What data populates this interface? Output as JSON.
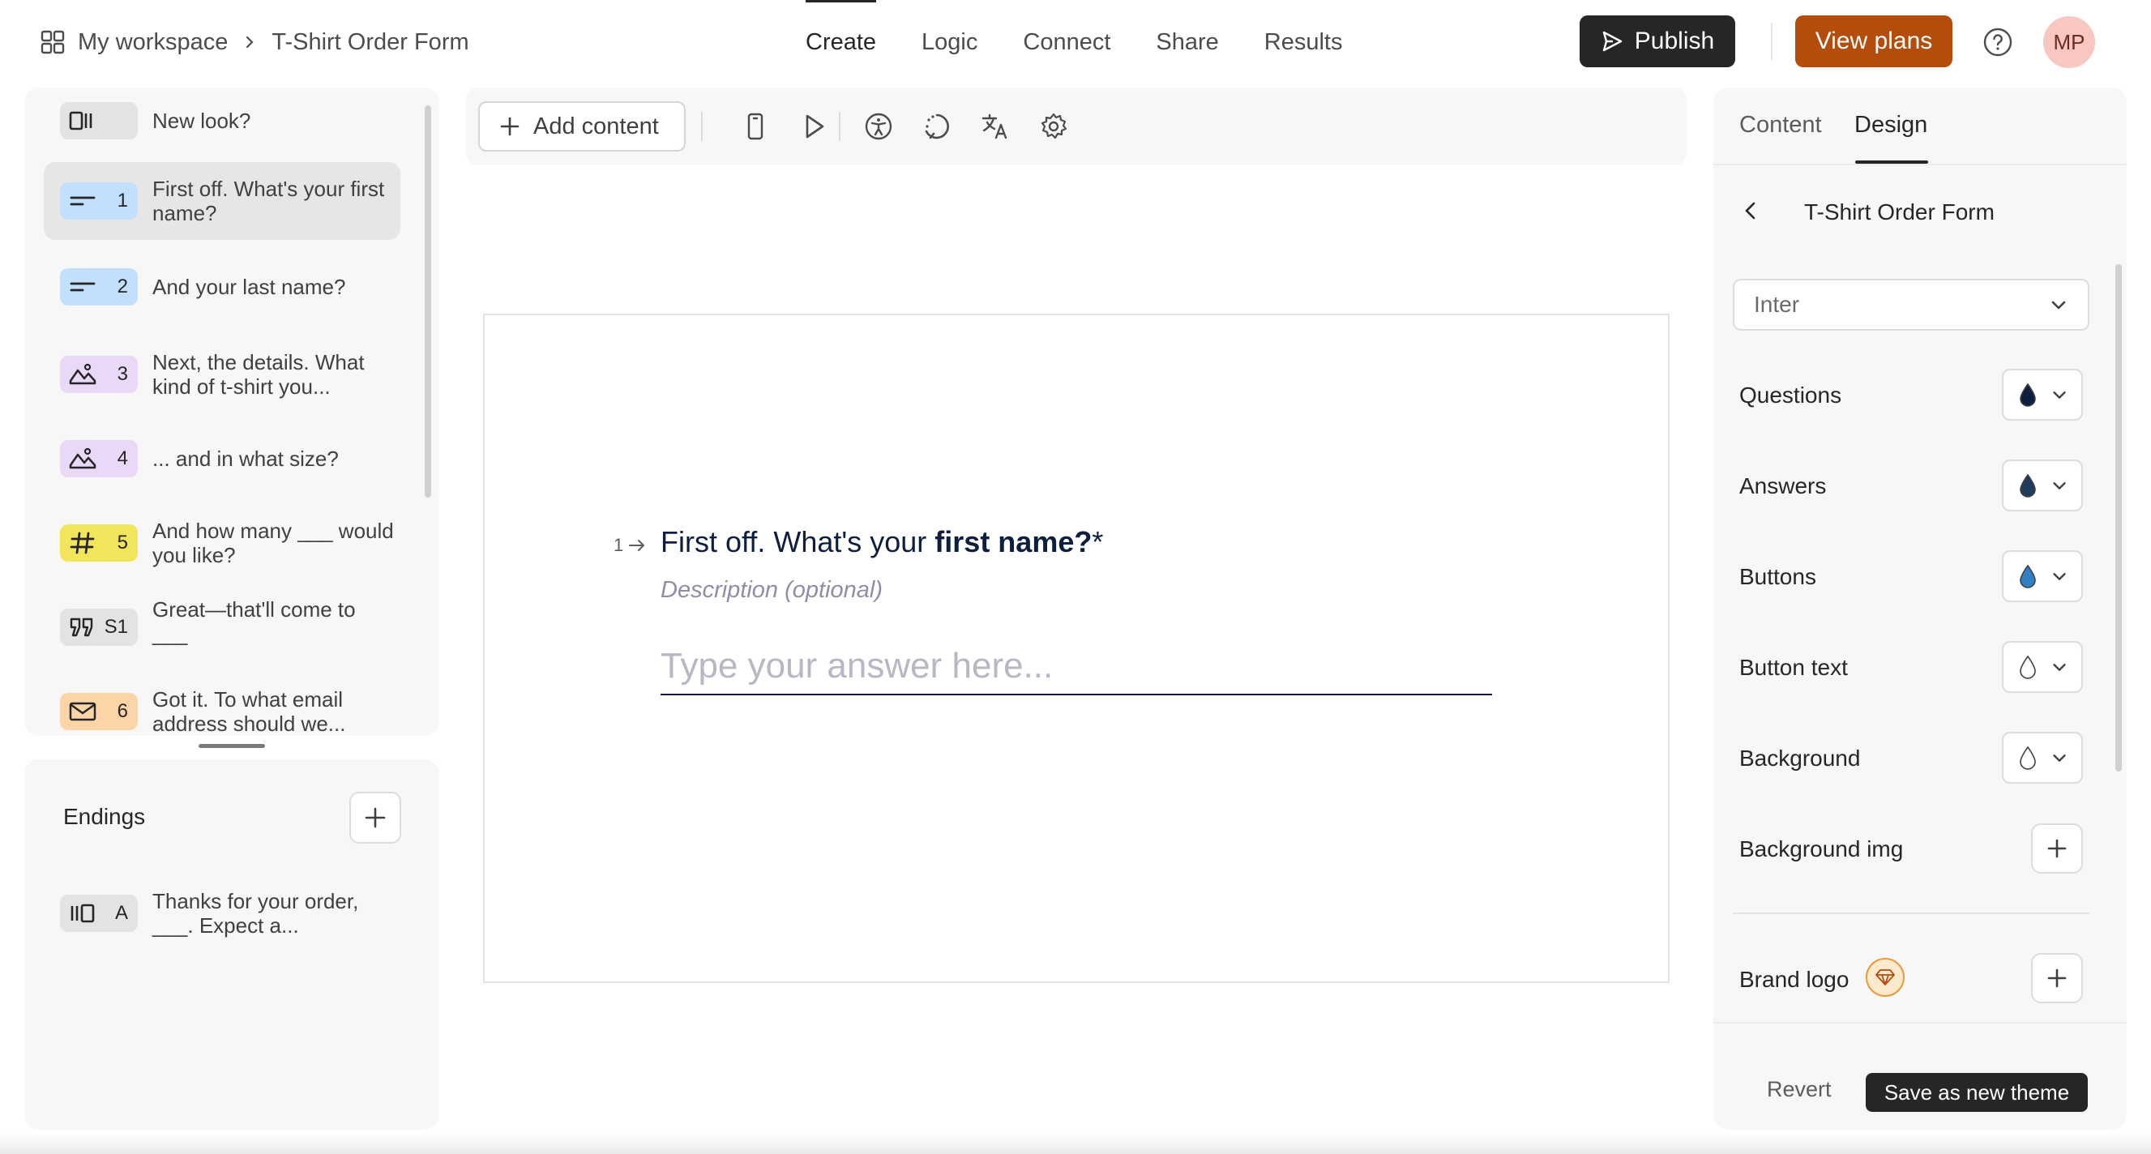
{
  "breadcrumb": {
    "workspace": "My workspace",
    "form": "T-Shirt Order Form"
  },
  "nav": {
    "tabs": [
      "Create",
      "Logic",
      "Connect",
      "Share",
      "Results"
    ],
    "active": "Create"
  },
  "header": {
    "publish_label": "Publish",
    "view_plans_label": "View plans",
    "avatar_initials": "MP"
  },
  "sidebar": {
    "items": [
      {
        "badge": "",
        "icon": "new-look-icon",
        "text": "New look?"
      },
      {
        "badge": "1",
        "icon": "short-text-icon",
        "text": "First off. What's your first name?"
      },
      {
        "badge": "2",
        "icon": "short-text-icon",
        "text": "And your last name?"
      },
      {
        "badge": "3",
        "icon": "picture-choice-icon",
        "text": "Next, the details. What kind of t-shirt you..."
      },
      {
        "badge": "4",
        "icon": "picture-choice-icon",
        "text": "... and in what size?"
      },
      {
        "badge": "5",
        "icon": "number-icon",
        "text": "And how many ___ would you like?"
      },
      {
        "badge": "S1",
        "icon": "quote-icon",
        "text": "Great—that'll come to ___"
      },
      {
        "badge": "6",
        "icon": "email-icon",
        "text": "Got it. To what email address should we..."
      }
    ],
    "selected_index": 1
  },
  "endings": {
    "title": "Endings",
    "items": [
      {
        "badge": "A",
        "icon": "ending-icon",
        "text": "Thanks for your order, ___. Expect a..."
      }
    ]
  },
  "toolbar": {
    "add_content_label": "Add content"
  },
  "question": {
    "number": "1",
    "title_prefix": "First off. What's your ",
    "title_bold": "first name?",
    "required_mark": "*",
    "description_placeholder": "Description (optional)",
    "answer_placeholder": "Type your answer here..."
  },
  "right_panel": {
    "tabs": [
      "Content",
      "Design"
    ],
    "active_tab": "Design",
    "form_title": "T-Shirt Order Form",
    "font": "Inter",
    "colors": [
      {
        "label": "Questions",
        "color": "#0e1f3d"
      },
      {
        "label": "Answers",
        "color": "#203a5c"
      },
      {
        "label": "Buttons",
        "color": "#2f80c4"
      },
      {
        "label": "Button text",
        "color": "#ffffff"
      },
      {
        "label": "Background",
        "color": "#ffffff"
      }
    ],
    "background_img_label": "Background img",
    "brand_logo_label": "Brand logo",
    "revert_label": "Revert",
    "save_theme_label": "Save as new theme"
  }
}
